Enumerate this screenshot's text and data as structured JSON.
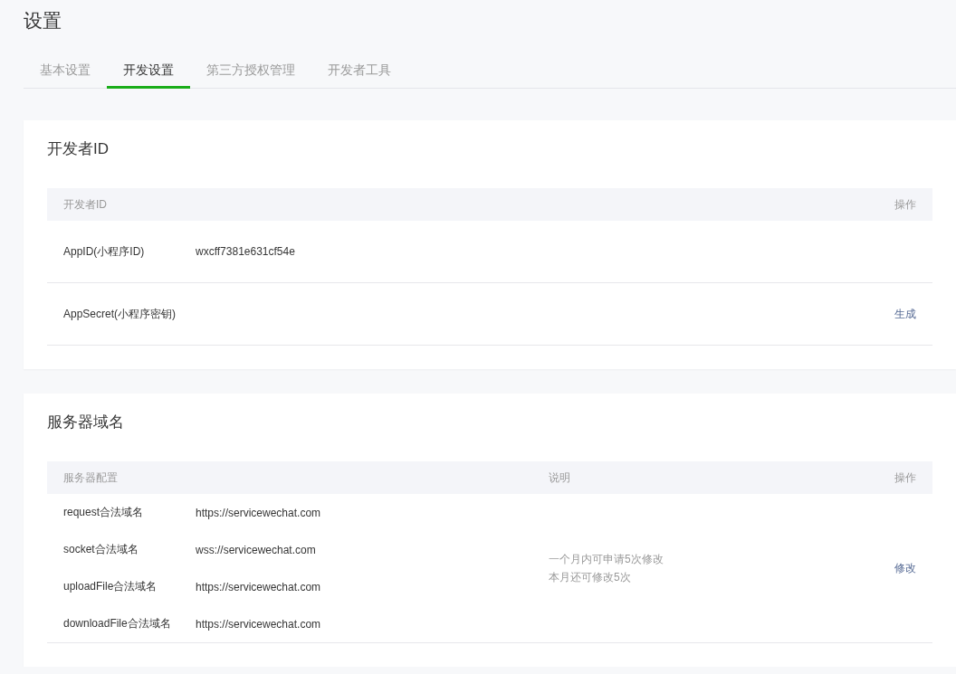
{
  "page_title": "设置",
  "tabs": [
    {
      "label": "基本设置",
      "selected": false
    },
    {
      "label": "开发设置",
      "selected": true
    },
    {
      "label": "第三方授权管理",
      "selected": false
    },
    {
      "label": "开发者工具",
      "selected": false
    }
  ],
  "developer_id": {
    "title": "开发者ID",
    "columns": [
      "开发者ID",
      "操作"
    ],
    "rows": [
      {
        "label": "AppID(小程序ID)",
        "value": "wxcff7381e631cf54e"
      },
      {
        "label": "AppSecret(小程序密钥)",
        "action": "生成"
      }
    ]
  },
  "server_domain": {
    "title": "服务器域名",
    "columns": [
      "服务器配置",
      "说明",
      "操作"
    ],
    "rows": [
      {
        "label": "request合法域名",
        "value": "https://servicewechat.com"
      },
      {
        "label": "socket合法域名",
        "value": "wss://servicewechat.com"
      },
      {
        "label": "uploadFile合法域名",
        "value": "https://servicewechat.com"
      },
      {
        "label": "downloadFile合法域名",
        "value": "https://servicewechat.com"
      }
    ],
    "note": [
      "一个月内可申请5次修改",
      "本月还可修改5次"
    ],
    "action": "修改"
  }
}
